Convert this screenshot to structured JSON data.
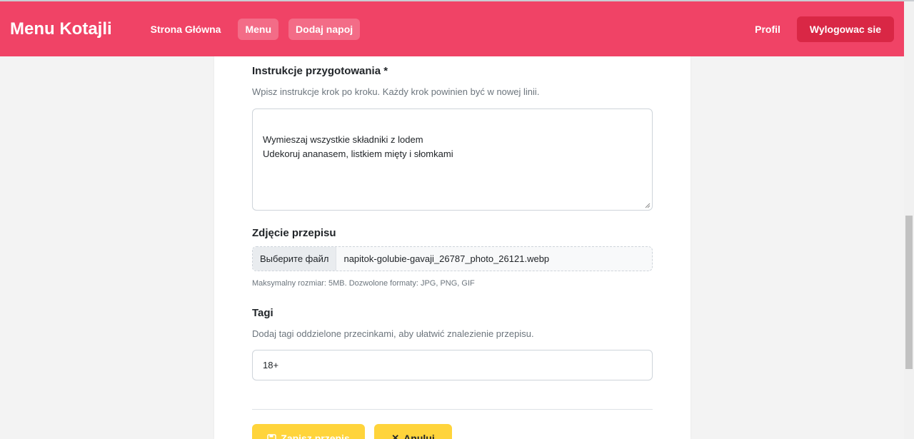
{
  "navbar": {
    "brand": "Menu Kotajli",
    "links": [
      {
        "label": "Strona Główna"
      },
      {
        "label": "Menu"
      },
      {
        "label": "Dodaj napoj"
      }
    ],
    "profile_label": "Profil",
    "logout_label": "Wylogowac sie",
    "colors": {
      "bar": "#f04366",
      "logout": "#d92745"
    }
  },
  "form": {
    "instructions": {
      "label": "Instrukcje przygotowania *",
      "hint": "Wpisz instrukcje krok po kroku. Każdy krok powinien być w nowej linii.",
      "value": "Wymieszaj wszystkie składniki z lodem\nUdekoruj ananasem, listkiem mięty i słomkami"
    },
    "photo": {
      "label": "Zdjęcie przepisu",
      "button_label": "Выберите файл",
      "file_name": "napitok-golubie-gavaji_26787_photo_26121.webp",
      "hint": "Maksymalny rozmiar: 5MB. Dozwolone formaty: JPG, PNG, GIF"
    },
    "tags": {
      "label": "Tagi",
      "hint": "Dodaj tagi oddzielone przecinkami, aby ułatwić znalezienie przepisu.",
      "value": "18+"
    },
    "actions": {
      "save_label": "Zapisz przepis",
      "save_icon": "floppy-icon",
      "cancel_label": "Anuluj",
      "cancel_icon": "close-icon",
      "color": "#ffd43b"
    }
  }
}
